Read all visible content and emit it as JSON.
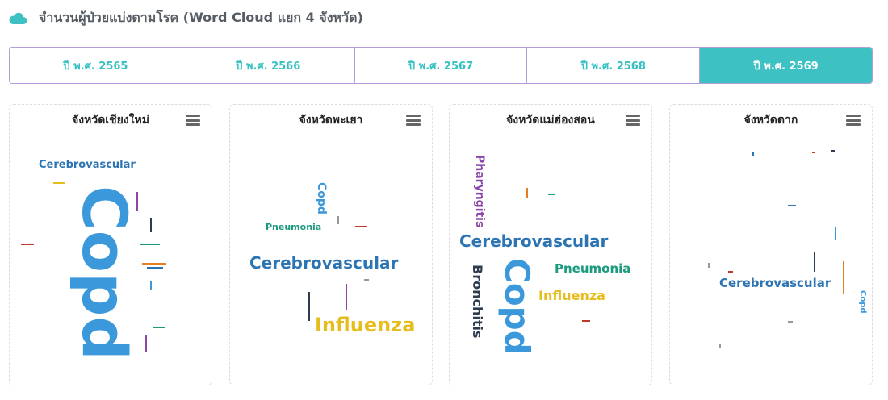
{
  "header": {
    "title": "จำนวนผู้ป่วยแบ่งตามโรค (Word Cloud แยก 4 จังหวัด)",
    "icon": "cloud-icon",
    "icon_color": "#3ec1c3"
  },
  "tabs": [
    {
      "label": "ปี พ.ศ. 2565",
      "active": false
    },
    {
      "label": "ปี พ.ศ. 2566",
      "active": false
    },
    {
      "label": "ปี พ.ศ. 2567",
      "active": false
    },
    {
      "label": "ปี พ.ศ. 2568",
      "active": false
    },
    {
      "label": "ปี พ.ศ. 2569",
      "active": true
    }
  ],
  "colors": {
    "copd": "#3a98db",
    "cerebrovascular": "#2d74b3",
    "influenza": "#e6bd1d",
    "pneumonia": "#1b9a80",
    "pharyngitis": "#8b46a8",
    "bronchitis": "#2c3e50",
    "accent": "#3ec1c3"
  },
  "provinces": [
    {
      "name": "จังหวัดเชียงใหม่",
      "words": [
        {
          "text": "Copd",
          "color": "#3a98db"
        },
        {
          "text": "Cerebrovascular",
          "color": "#2d74b3"
        }
      ]
    },
    {
      "name": "จังหวัดพะเยา",
      "words": [
        {
          "text": "Cerebrovascular",
          "color": "#2d74b3"
        },
        {
          "text": "Influenza",
          "color": "#e6bd1d"
        },
        {
          "text": "Copd",
          "color": "#3a98db"
        },
        {
          "text": "Pneumonia",
          "color": "#1b9a80"
        }
      ]
    },
    {
      "name": "จังหวัดแม่ฮ่องสอน",
      "words": [
        {
          "text": "Cerebrovascular",
          "color": "#2d74b3"
        },
        {
          "text": "Copd",
          "color": "#3a98db"
        },
        {
          "text": "Bronchitis",
          "color": "#2c3e50"
        },
        {
          "text": "Pharyngitis",
          "color": "#8b46a8"
        },
        {
          "text": "Pneumonia",
          "color": "#1b9a80"
        },
        {
          "text": "Influenza",
          "color": "#e6bd1d"
        }
      ]
    },
    {
      "name": "จังหวัดตาก",
      "words": [
        {
          "text": "Cerebrovascular",
          "color": "#2d74b3"
        },
        {
          "text": "Copd",
          "color": "#3a98db"
        }
      ]
    }
  ]
}
